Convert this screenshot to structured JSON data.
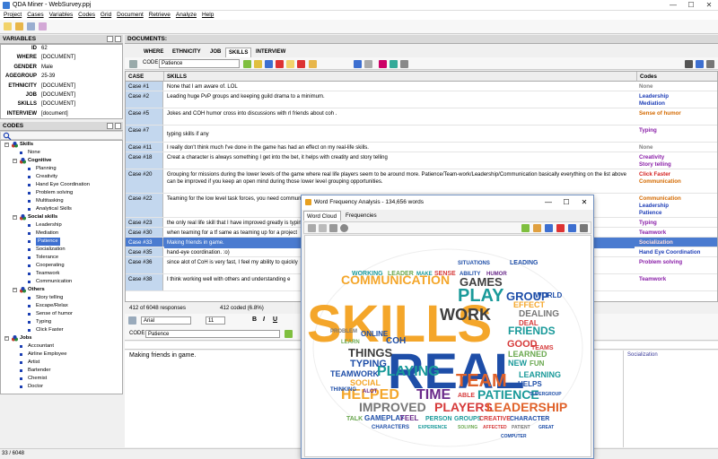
{
  "window": {
    "title": "QDA Miner - WebSurvey.ppj",
    "min": "—",
    "max": "☐",
    "close": "✕"
  },
  "menu": [
    "Project",
    "Cases",
    "Variables",
    "Codes",
    "Grid",
    "Document",
    "Retrieve",
    "Analyze",
    "Help"
  ],
  "variables_panel": {
    "title": "VARIABLES",
    "rows": [
      {
        "key": "ID",
        "value": "62"
      },
      {
        "key": "WHERE",
        "value": "[DOCUMENT]"
      },
      {
        "key": "GENDER",
        "value": "Male"
      },
      {
        "key": "AGEGROUP",
        "value": "25-39"
      },
      {
        "key": "ETHNICITY",
        "value": "[DOCUMENT]"
      },
      {
        "key": "JOB",
        "value": "[DOCUMENT]"
      },
      {
        "key": "SKILLS",
        "value": "[DOCUMENT]"
      },
      {
        "key": "INTERVIEW",
        "value": "[document]"
      }
    ]
  },
  "codes_panel": {
    "title": "CODES",
    "search_icon": "magnifier-icon",
    "items": [
      {
        "label": "Skills",
        "level": 0,
        "group": true,
        "color": "#c0392b"
      },
      {
        "label": "None",
        "level": 1
      },
      {
        "label": "Cognitive",
        "level": 1,
        "group": true,
        "color": "#c0392b"
      },
      {
        "label": "Planning",
        "level": 2
      },
      {
        "label": "Creativity",
        "level": 2
      },
      {
        "label": "Hand Eye Coordination",
        "level": 2
      },
      {
        "label": "Problem solving",
        "level": 2
      },
      {
        "label": "Multitasking",
        "level": 2
      },
      {
        "label": "Analytical Skills",
        "level": 2
      },
      {
        "label": "Social skills",
        "level": 1,
        "group": true,
        "color": "#c0392b"
      },
      {
        "label": "Leadership",
        "level": 2
      },
      {
        "label": "Mediation",
        "level": 2
      },
      {
        "label": "Patience",
        "level": 2,
        "selected": true
      },
      {
        "label": "Socialization",
        "level": 2
      },
      {
        "label": "Tolerance",
        "level": 2
      },
      {
        "label": "Cooperating",
        "level": 2
      },
      {
        "label": "Teamwork",
        "level": 2
      },
      {
        "label": "Communication",
        "level": 2
      },
      {
        "label": "Others",
        "level": 1,
        "group": true,
        "color": "#c0392b"
      },
      {
        "label": "Story telling",
        "level": 2
      },
      {
        "label": "Escape/Relax",
        "level": 2
      },
      {
        "label": "Sense of humor",
        "level": 2
      },
      {
        "label": "Typing",
        "level": 2
      },
      {
        "label": "Click Faster",
        "level": 2
      },
      {
        "label": "Jobs",
        "level": 0,
        "group": true,
        "color": "#c0392b"
      },
      {
        "label": "Accountant",
        "level": 1
      },
      {
        "label": "Airline Employee",
        "level": 1
      },
      {
        "label": "Artist",
        "level": 1
      },
      {
        "label": "Bartender",
        "level": 1
      },
      {
        "label": "Chemist",
        "level": 1
      },
      {
        "label": "Doctor",
        "level": 1
      }
    ]
  },
  "documents": {
    "title": "DOCUMENTS:",
    "tabs": [
      "WHERE",
      "ETHNICITY",
      "JOB",
      "SKILLS",
      "INTERVIEW"
    ],
    "active_tab": "SKILLS",
    "code_label": "CODE:",
    "code_value": "Patience"
  },
  "grid": {
    "headers": {
      "case": "CASE",
      "text": "SKILLS",
      "codes": "Codes"
    },
    "rows": [
      {
        "case": "Case #1",
        "text": "None that I am aware of. LOL",
        "codes": [
          {
            "t": "None",
            "c": "#808080"
          }
        ]
      },
      {
        "case": "Case #2",
        "text": "Leading huge PvP groups and keeping guild drama to a minimum.",
        "codes": [
          {
            "t": "Leadership",
            "c": "#1f3fb7"
          },
          {
            "t": "Mediation",
            "c": "#1f3fb7"
          }
        ]
      },
      {
        "case": "Case #5",
        "text": "Jokes and COH humor cross into discussions with rl friends about coh .",
        "codes": [
          {
            "t": "Sense of humor",
            "c": "#d46a00"
          }
        ]
      },
      {
        "case": "Case #7",
        "text": "typing skills if any",
        "codes": [
          {
            "t": "Typing",
            "c": "#8a1fa8"
          }
        ]
      },
      {
        "case": "Case #11",
        "text": "I really don't think much I've done in the game has had an effect on my real-life skills.",
        "codes": [
          {
            "t": "None",
            "c": "#808080"
          }
        ]
      },
      {
        "case": "Case #18",
        "text": "Creat a character is always something I get into the bet, it helps with creatity and story telling",
        "codes": [
          {
            "t": "Creativity",
            "c": "#8a1fa8"
          },
          {
            "t": "Story telling",
            "c": "#8a1fa8"
          }
        ]
      },
      {
        "case": "Case #20",
        "text": "Grouping for missions during the lower levels of the game where real life players seem to be around more. Patience/Team-work/Leadership/Communication basically everything on the list above can be improved if you keep an open mind during those lower level grouping opportunities.",
        "codes": [
          {
            "t": "Click Faster",
            "c": "#d42020"
          },
          {
            "t": "Communication",
            "c": "#d46a00"
          }
        ]
      },
      {
        "case": "Case #22",
        "text": "Teaming for the low level task forces, you need communication between players and sometimes even leadership skills and patience when juggling cats.",
        "codes": [
          {
            "t": "Communication",
            "c": "#d46a00"
          },
          {
            "t": "Leadership",
            "c": "#1f3fb7"
          },
          {
            "t": "Patience",
            "c": "#1f3fb7"
          }
        ]
      },
      {
        "case": "Case #23",
        "text": "the only real life skill that I have improved greatly is typing",
        "codes": [
          {
            "t": "Typing",
            "c": "#8a1fa8"
          }
        ]
      },
      {
        "case": "Case #30",
        "text": "when teaming for a tf same as teaming up for a project",
        "codes": [
          {
            "t": "Teamwork",
            "c": "#8a1fa8"
          }
        ]
      },
      {
        "case": "Case #33",
        "text": "Making friends in game.",
        "codes": [
          {
            "t": "Socialization",
            "c": "#d42020"
          }
        ],
        "selected": true
      },
      {
        "case": "Case #35",
        "text": "hand-eye coordination. :o)",
        "codes": [
          {
            "t": "Hand Eye Coordination",
            "c": "#1f3fb7"
          }
        ]
      },
      {
        "case": "Case #36",
        "text": "since alot of CoH is very fast, I feel my ability to quickly",
        "codes": [
          {
            "t": "Problem solving",
            "c": "#8a1fa8"
          }
        ]
      },
      {
        "case": "Case #38",
        "text": "I think working well with others and understanding e",
        "codes": [
          {
            "t": "Teamwork",
            "c": "#8a1fa8"
          }
        ]
      }
    ]
  },
  "grid_status": {
    "responses": "412 of 6048 responses",
    "coded": "412 coded (6.8%)"
  },
  "editor": {
    "font": "Arial",
    "size": "11",
    "bold": "B",
    "italic": "I",
    "underline": "U",
    "code_label": "CODE:",
    "code_value": "Patience",
    "text": "Making friends in game.",
    "margin_tag": "Socialization"
  },
  "statusbar": {
    "position": "33 / 6048"
  },
  "word_freq": {
    "title": "Word Frequency Analysis - 134,656 words",
    "tabs": [
      "Word Cloud",
      "Frequencies"
    ],
    "active_tab": "Word Cloud",
    "words": [
      {
        "w": "SKILLS",
        "c": "#f4a62a"
      },
      {
        "w": "REAL",
        "c": "#1e4ea8"
      },
      {
        "w": "PLAY",
        "c": "#1a9a9a"
      },
      {
        "w": "WORK",
        "c": "#3f3f3f"
      },
      {
        "w": "COMMUNICATION",
        "c": "#f4a62a"
      },
      {
        "w": "GAMES",
        "c": "#3f3f3f"
      },
      {
        "w": "GROUP",
        "c": "#1e4ea8"
      },
      {
        "w": "TEAM",
        "c": "#e0622a"
      },
      {
        "w": "PLAYING",
        "c": "#1a9a9a"
      },
      {
        "w": "HELPED",
        "c": "#f4a62a"
      },
      {
        "w": "TIME",
        "c": "#6a2a8a"
      },
      {
        "w": "PATIENCE",
        "c": "#1a9a9a"
      },
      {
        "w": "IMPROVED",
        "c": "#777777"
      },
      {
        "w": "PLAYERS",
        "c": "#d63a3a"
      },
      {
        "w": "LEADERSHIP",
        "c": "#e0622a"
      },
      {
        "w": "FRIENDS",
        "c": "#1a9a9a"
      },
      {
        "w": "GOOD",
        "c": "#d63a3a"
      },
      {
        "w": "COH",
        "c": "#1e4ea8"
      },
      {
        "w": "THINGS",
        "c": "#3f3f3f"
      },
      {
        "w": "TYPING",
        "c": "#1e4ea8"
      },
      {
        "w": "DEALING",
        "c": "#777777"
      },
      {
        "w": "EFFECT",
        "c": "#f4a62a"
      },
      {
        "w": "LEARNED",
        "c": "#6aa84f"
      },
      {
        "w": "LEARNING",
        "c": "#1a9a9a"
      },
      {
        "w": "HELPS",
        "c": "#1e4ea8"
      },
      {
        "w": "ONLINE",
        "c": "#1e4ea8"
      },
      {
        "w": "ABLE",
        "c": "#d63a3a"
      },
      {
        "w": "SOCIAL",
        "c": "#f4a62a"
      },
      {
        "w": "TEAMWORK",
        "c": "#1e4ea8"
      },
      {
        "w": "DEAL",
        "c": "#d63a3a"
      },
      {
        "w": "NEW",
        "c": "#1a9a9a"
      },
      {
        "w": "FUN",
        "c": "#6aa84f"
      },
      {
        "w": "WORLD",
        "c": "#1e4ea8"
      },
      {
        "w": "GAMEPLAY",
        "c": "#1e4ea8"
      },
      {
        "w": "FEEL",
        "c": "#6a2a8a"
      },
      {
        "w": "PERSON",
        "c": "#1a9a9a"
      },
      {
        "w": "GROUPS",
        "c": "#1a9a9a"
      },
      {
        "w": "CREATIVE",
        "c": "#d63a3a"
      },
      {
        "w": "CHARACTER",
        "c": "#1e4ea8"
      },
      {
        "w": "WORKING",
        "c": "#1a9a9a"
      },
      {
        "w": "LEADER",
        "c": "#6aa84f"
      },
      {
        "w": "SENSE",
        "c": "#d63a3a"
      },
      {
        "w": "ABILITY",
        "c": "#1e4ea8"
      },
      {
        "w": "HUMOR",
        "c": "#6a2a8a"
      },
      {
        "w": "MAKE",
        "c": "#1a9a9a"
      },
      {
        "w": "TEAMS",
        "c": "#d63a3a"
      },
      {
        "w": "SITUATIONS",
        "c": "#1e4ea8"
      },
      {
        "w": "LEADING",
        "c": "#1e4ea8"
      },
      {
        "w": "CHARACTERS",
        "c": "#1e4ea8"
      },
      {
        "w": "EXPERIENCE",
        "c": "#1a9a9a"
      },
      {
        "w": "SOLVING",
        "c": "#6aa84f"
      },
      {
        "w": "AFFECTED",
        "c": "#d63a3a"
      },
      {
        "w": "PATIENT",
        "c": "#777777"
      },
      {
        "w": "GREAT",
        "c": "#1e4ea8"
      },
      {
        "w": "COMPUTER",
        "c": "#1e4ea8"
      },
      {
        "w": "SUPERGROUP",
        "c": "#1e4ea8"
      },
      {
        "w": "ALOT",
        "c": "#6a2a8a"
      },
      {
        "w": "THINKING",
        "c": "#1e4ea8"
      },
      {
        "w": "TALK",
        "c": "#6aa84f"
      },
      {
        "w": "PROBLEM",
        "c": "#777777"
      },
      {
        "w": "LEARN",
        "c": "#6aa84f"
      }
    ]
  }
}
